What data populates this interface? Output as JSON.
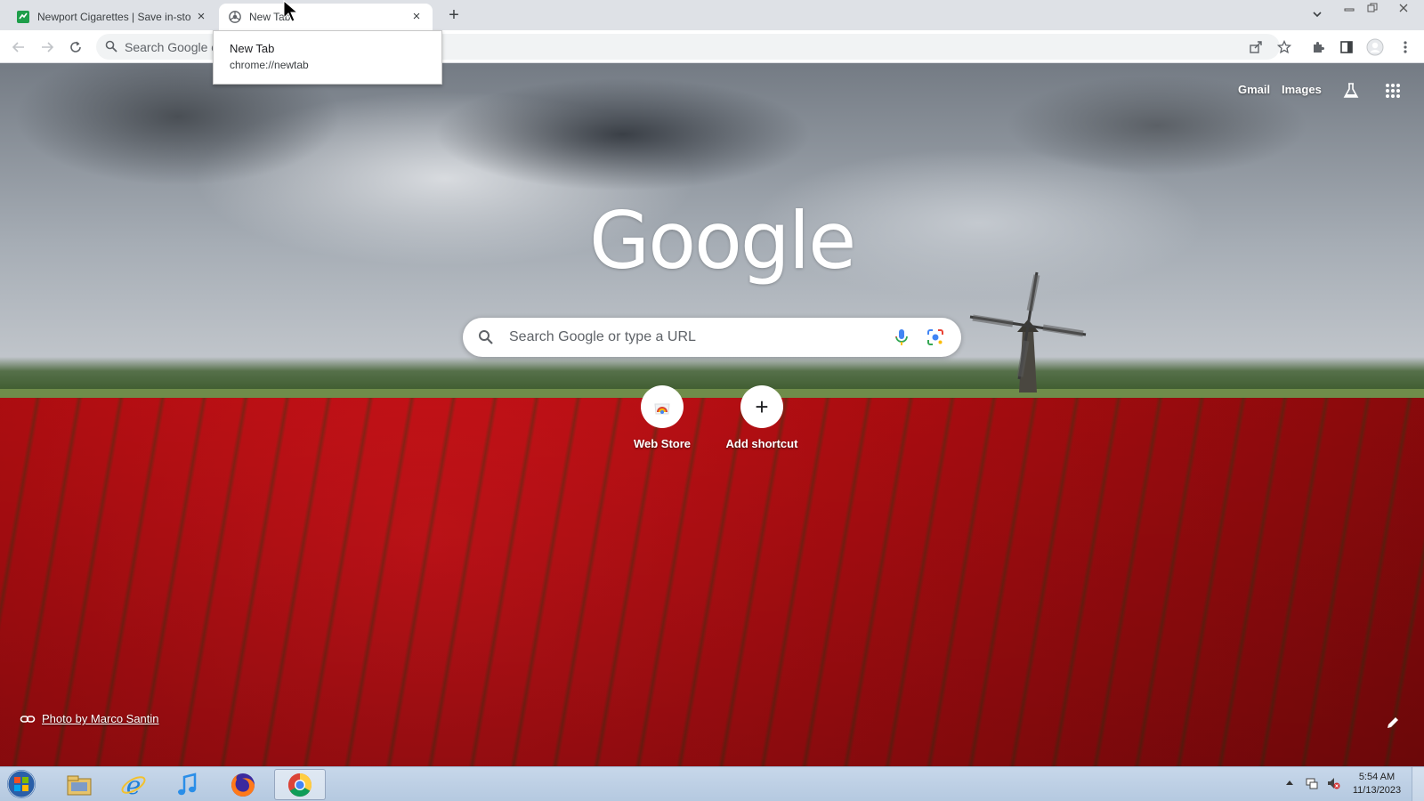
{
  "browser": {
    "tabs": [
      {
        "title": "Newport Cigarettes | Save in-sto",
        "active": false
      },
      {
        "title": "New Tab",
        "active": true
      }
    ],
    "new_tab_symbol": "+",
    "close_symbol": "×",
    "omnibox_text": "Search Google o"
  },
  "tooltip": {
    "title": "New Tab",
    "url": "chrome://newtab"
  },
  "ntp": {
    "top_links": {
      "gmail": "Gmail",
      "images": "Images"
    },
    "logo_text": "Google",
    "search_placeholder": "Search Google or type a URL",
    "shortcuts": [
      {
        "label": "Web Store"
      },
      {
        "label": "Add shortcut",
        "symbol": "+"
      }
    ],
    "attribution": "Photo by Marco Santin"
  },
  "taskbar": {
    "time": "5:54 AM",
    "date": "11/13/2023",
    "apps": [
      "windows-explorer",
      "internet-explorer",
      "itunes",
      "firefox",
      "chrome"
    ]
  },
  "colors": {
    "accent_blue": "#1a73e8",
    "tab_strip": "#dee1e6",
    "taskbar": "#c7d7ea"
  }
}
